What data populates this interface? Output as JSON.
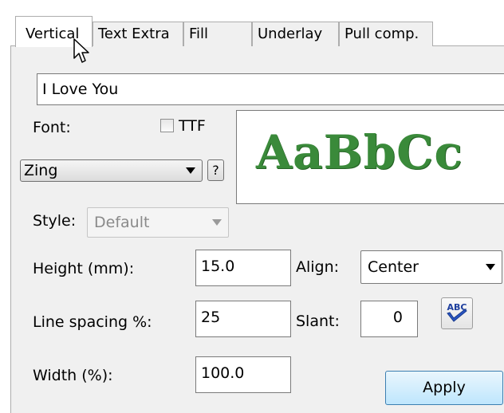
{
  "tabs": [
    {
      "label": "Vertical",
      "active": true
    },
    {
      "label": "Text Extra"
    },
    {
      "label": "Fill"
    },
    {
      "label": "Underlay"
    },
    {
      "label": "Pull comp."
    }
  ],
  "text_input": {
    "value": "I Love You"
  },
  "font": {
    "label": "Font:",
    "ttf_label": "TTF",
    "ttf_checked": false,
    "selected": "Zing",
    "help_label": "?"
  },
  "preview": {
    "text": "AaBbCc",
    "color": "#3a8a3a"
  },
  "style": {
    "label": "Style:",
    "selected": "Default",
    "disabled": true
  },
  "height": {
    "label": "Height (mm):",
    "value": "15.0"
  },
  "align": {
    "label": "Align:",
    "selected": "Center"
  },
  "line_spacing": {
    "label": "Line spacing %:",
    "value": "25"
  },
  "slant": {
    "label": "Slant:",
    "value": "0"
  },
  "width": {
    "label": "Width (%):",
    "value": "100.0"
  },
  "spellcheck": {
    "icon": "abc-check-icon",
    "text": "ABC"
  },
  "apply_button": {
    "label": "Apply"
  },
  "cursor": {
    "icon": "mouse-pointer-icon"
  }
}
